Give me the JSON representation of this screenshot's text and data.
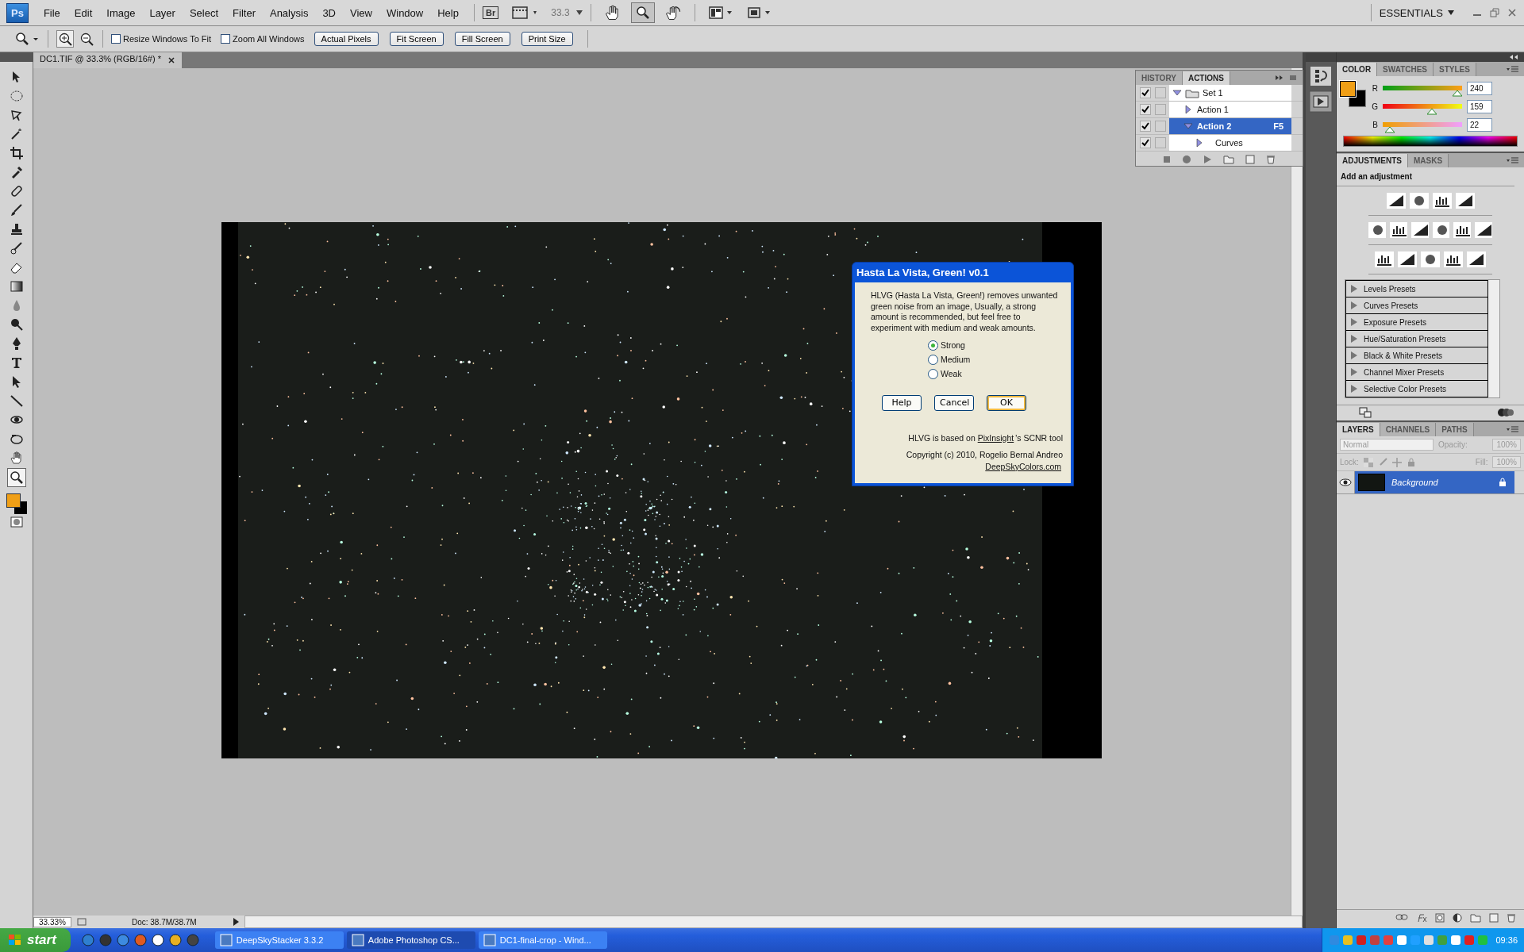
{
  "menu_bar": {
    "logo": "Ps",
    "items": [
      "File",
      "Edit",
      "Image",
      "Layer",
      "Select",
      "Filter",
      "Analysis",
      "3D",
      "View",
      "Window",
      "Help"
    ],
    "bridge": "Br",
    "zoom_value": "33.3",
    "workspace": "ESSENTIALS"
  },
  "options_bar": {
    "checkboxes": [
      {
        "label": "Resize Windows To Fit",
        "checked": false
      },
      {
        "label": "Zoom All Windows",
        "checked": false
      }
    ],
    "buttons": [
      "Actual Pixels",
      "Fit Screen",
      "Fill Screen",
      "Print Size"
    ]
  },
  "document_tab": {
    "title": "DC1.TIF @ 33.3% (RGB/16#) *"
  },
  "actions_panel": {
    "tabs": [
      {
        "label": "HISTORY",
        "selected": false
      },
      {
        "label": "ACTIONS",
        "selected": true
      }
    ],
    "rows": [
      {
        "label": "Set 1",
        "kind": "set",
        "checked": true,
        "expanded": true,
        "selected": false,
        "children": [
          {
            "label": "Action 1",
            "kind": "action",
            "checked": true,
            "expanded": false,
            "selected": false
          },
          {
            "label": "Action 2",
            "kind": "action",
            "checked": true,
            "expanded": true,
            "selected": true,
            "shortcut": "F5",
            "children": [
              {
                "label": "Curves",
                "kind": "step",
                "checked": true,
                "expanded": false,
                "selected": false
              }
            ]
          }
        ]
      }
    ]
  },
  "color_panel": {
    "tabs": [
      {
        "label": "COLOR",
        "selected": true
      },
      {
        "label": "SWATCHES",
        "selected": false
      },
      {
        "label": "STYLES",
        "selected": false
      }
    ],
    "channels": [
      {
        "name": "R",
        "value": "240",
        "level": 0.94
      },
      {
        "name": "G",
        "value": "159",
        "level": 0.62
      },
      {
        "name": "B",
        "value": "22",
        "level": 0.09
      }
    ]
  },
  "adjustments_panel": {
    "tabs": [
      {
        "label": "ADJUSTMENTS",
        "selected": true
      },
      {
        "label": "MASKS",
        "selected": false
      }
    ],
    "heading": "Add an adjustment",
    "presets": [
      "Levels Presets",
      "Curves Presets",
      "Exposure Presets",
      "Hue/Saturation Presets",
      "Black & White Presets",
      "Channel Mixer Presets",
      "Selective Color Presets"
    ]
  },
  "layers_panel": {
    "tabs": [
      {
        "label": "LAYERS",
        "selected": true
      },
      {
        "label": "CHANNELS",
        "selected": false
      },
      {
        "label": "PATHS",
        "selected": false
      }
    ],
    "blend_mode": "Normal",
    "opacity_label": "Opacity:",
    "opacity": "100%",
    "lock_label": "Lock:",
    "fill_label": "Fill:",
    "fill": "100%",
    "layers": [
      {
        "name": "Background",
        "selected": true,
        "visible": true,
        "locked": true
      }
    ]
  },
  "dialog": {
    "title": "Hasta La Vista, Green! v0.1",
    "description": "HLVG (Hasta La Vista, Green!) removes unwanted green noise from an image, Usually, a strong amount is recommended, but feel free to experiment with medium and weak amounts.",
    "options": [
      {
        "label": "Strong",
        "selected": true
      },
      {
        "label": "Medium",
        "selected": false
      },
      {
        "label": "Weak",
        "selected": false
      }
    ],
    "buttons": [
      {
        "label": "Help",
        "default": false
      },
      {
        "label": "Cancel",
        "default": false
      },
      {
        "label": "OK",
        "default": true
      }
    ],
    "credit_before": "HLVG is based on ",
    "credit_link": "PixInsight",
    "credit_after": "'s SCNR tool",
    "copyright": "Copyright (c) 2010, Rogelio Bernal Andreo",
    "website": "DeepSkyColors.com"
  },
  "status_bar": {
    "zoom": "33.33%",
    "doc_info": "Doc: 38.7M/38.7M"
  },
  "taskbar": {
    "start": "start",
    "tasks": [
      {
        "label": "DeepSkyStacker 3.3.2",
        "selected": false
      },
      {
        "label": "Adobe Photoshop CS...",
        "selected": true
      },
      {
        "label": "DC1-final-crop - Wind...",
        "selected": false
      }
    ],
    "clock": "09:36"
  }
}
